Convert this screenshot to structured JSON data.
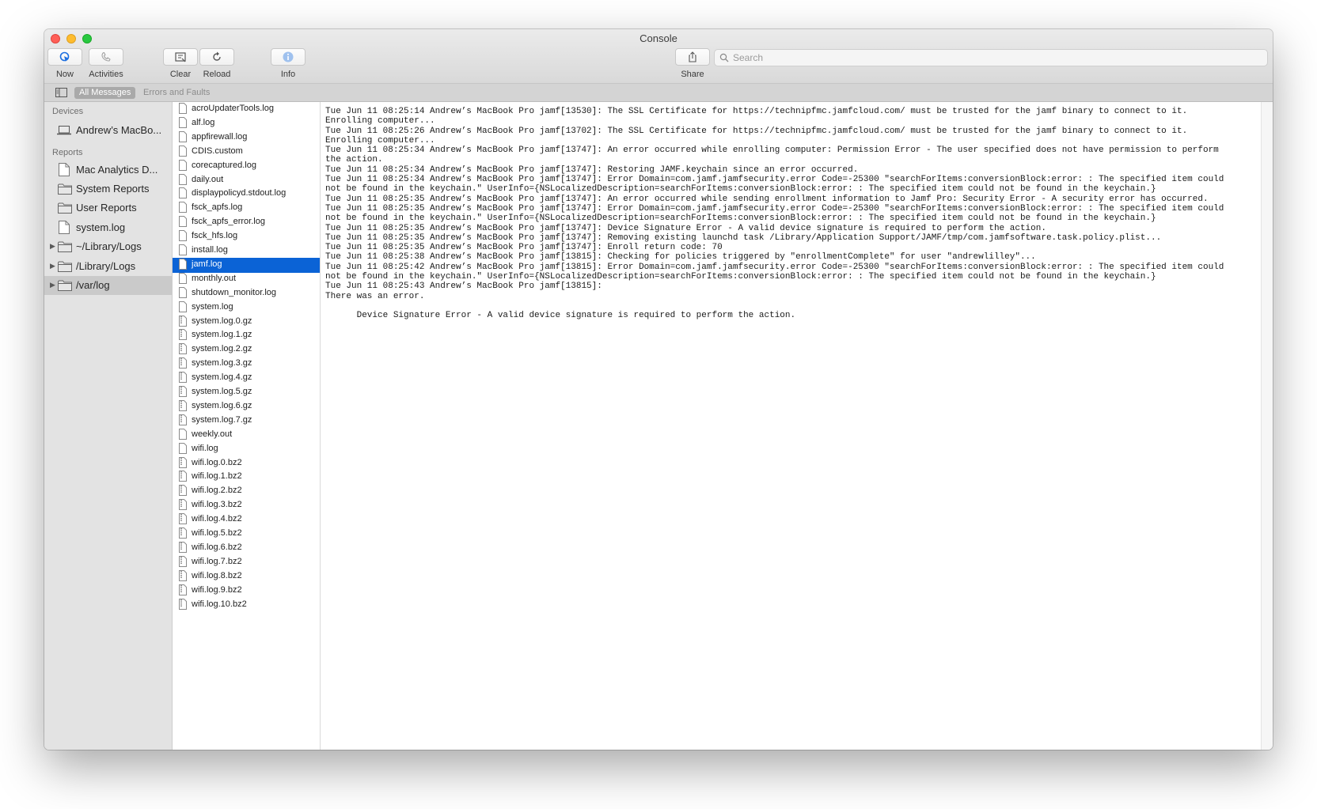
{
  "window": {
    "title": "Console"
  },
  "toolbar": {
    "now_label": "Now",
    "activities_label": "Activities",
    "clear_label": "Clear",
    "reload_label": "Reload",
    "info_label": "Info",
    "share_label": "Share",
    "search_placeholder": "Search"
  },
  "filter": {
    "all_messages": "All Messages",
    "errors_and_faults": "Errors and Faults"
  },
  "sidebar": {
    "devices_header": "Devices",
    "reports_header": "Reports",
    "device_name": "Andrew’s MacBo...",
    "items": [
      {
        "label": "Mac Analytics D...",
        "icon": "document-icon"
      },
      {
        "label": "System Reports",
        "icon": "folder-icon"
      },
      {
        "label": "User Reports",
        "icon": "folder-icon"
      },
      {
        "label": "system.log",
        "icon": "document-icon"
      },
      {
        "label": "~/Library/Logs",
        "icon": "folder-icon"
      },
      {
        "label": "/Library/Logs",
        "icon": "folder-icon"
      },
      {
        "label": "/var/log",
        "icon": "folder-icon",
        "selected": true
      }
    ]
  },
  "files": [
    "acroUpdaterTools.log",
    "alf.log",
    "appfirewall.log",
    "CDIS.custom",
    "corecaptured.log",
    "daily.out",
    "displaypolicyd.stdout.log",
    "fsck_apfs.log",
    "fsck_apfs_error.log",
    "fsck_hfs.log",
    "install.log",
    "jamf.log",
    "monthly.out",
    "shutdown_monitor.log",
    "system.log",
    "system.log.0.gz",
    "system.log.1.gz",
    "system.log.2.gz",
    "system.log.3.gz",
    "system.log.4.gz",
    "system.log.5.gz",
    "system.log.6.gz",
    "system.log.7.gz",
    "weekly.out",
    "wifi.log",
    "wifi.log.0.bz2",
    "wifi.log.1.bz2",
    "wifi.log.2.bz2",
    "wifi.log.3.bz2",
    "wifi.log.4.bz2",
    "wifi.log.5.bz2",
    "wifi.log.6.bz2",
    "wifi.log.7.bz2",
    "wifi.log.8.bz2",
    "wifi.log.9.bz2",
    "wifi.log.10.bz2"
  ],
  "selected_file": "jamf.log",
  "log_lines": [
    "Tue Jun 11 08:25:14 Andrew’s MacBook Pro jamf[13530]: The SSL Certificate for https://technipfmc.jamfcloud.com/ must be trusted for the jamf binary to connect to it.",
    "Enrolling computer...",
    "Tue Jun 11 08:25:26 Andrew’s MacBook Pro jamf[13702]: The SSL Certificate for https://technipfmc.jamfcloud.com/ must be trusted for the jamf binary to connect to it.",
    "Enrolling computer...",
    "Tue Jun 11 08:25:34 Andrew’s MacBook Pro jamf[13747]: An error occurred while enrolling computer: Permission Error - The user specified does not have permission to perform",
    "the action.",
    "Tue Jun 11 08:25:34 Andrew’s MacBook Pro jamf[13747]: Restoring JAMF.keychain since an error occurred.",
    "Tue Jun 11 08:25:34 Andrew’s MacBook Pro jamf[13747]: Error Domain=com.jamf.jamfsecurity.error Code=-25300 \"searchForItems:conversionBlock:error: : The specified item could",
    "not be found in the keychain.\" UserInfo={NSLocalizedDescription=searchForItems:conversionBlock:error: : The specified item could not be found in the keychain.}",
    "Tue Jun 11 08:25:35 Andrew’s MacBook Pro jamf[13747]: An error occurred while sending enrollment information to Jamf Pro: Security Error - A security error has occurred.",
    "Tue Jun 11 08:25:35 Andrew’s MacBook Pro jamf[13747]: Error Domain=com.jamf.jamfsecurity.error Code=-25300 \"searchForItems:conversionBlock:error: : The specified item could",
    "not be found in the keychain.\" UserInfo={NSLocalizedDescription=searchForItems:conversionBlock:error: : The specified item could not be found in the keychain.}",
    "Tue Jun 11 08:25:35 Andrew’s MacBook Pro jamf[13747]: Device Signature Error - A valid device signature is required to perform the action.",
    "Tue Jun 11 08:25:35 Andrew’s MacBook Pro jamf[13747]: Removing existing launchd task /Library/Application Support/JAMF/tmp/com.jamfsoftware.task.policy.plist...",
    "Tue Jun 11 08:25:35 Andrew’s MacBook Pro jamf[13747]: Enroll return code: 70",
    "Tue Jun 11 08:25:38 Andrew’s MacBook Pro jamf[13815]: Checking for policies triggered by \"enrollmentComplete\" for user \"andrewlilley\"...",
    "Tue Jun 11 08:25:42 Andrew’s MacBook Pro jamf[13815]: Error Domain=com.jamf.jamfsecurity.error Code=-25300 \"searchForItems:conversionBlock:error: : The specified item could",
    "not be found in the keychain.\" UserInfo={NSLocalizedDescription=searchForItems:conversionBlock:error: : The specified item could not be found in the keychain.}",
    "Tue Jun 11 08:25:43 Andrew’s MacBook Pro jamf[13815]:",
    "There was an error.",
    "",
    "      Device Signature Error - A valid device signature is required to perform the action."
  ]
}
